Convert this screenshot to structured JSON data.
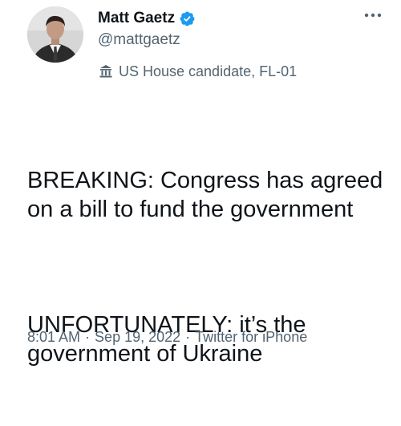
{
  "author": {
    "display_name": "Matt Gaetz",
    "handle": "@mattgaetz",
    "verified": true,
    "avatar_icon": "profile-photo",
    "label_icon": "government-building-icon",
    "label_text": "US House candidate, FL-01"
  },
  "tweet": {
    "paragraph_1": "BREAKING: Congress has agreed on a bill to fund the government",
    "paragraph_2": "UNFORTUNATELY: it’s the government of Ukraine"
  },
  "meta": {
    "time": "8:01 AM",
    "separator": "·",
    "date": "Sep 19, 2022",
    "source": "Twitter for iPhone"
  },
  "colors": {
    "verified_blue": "#1d9bf0",
    "secondary_text": "#536471",
    "primary_text": "#0f1419"
  }
}
